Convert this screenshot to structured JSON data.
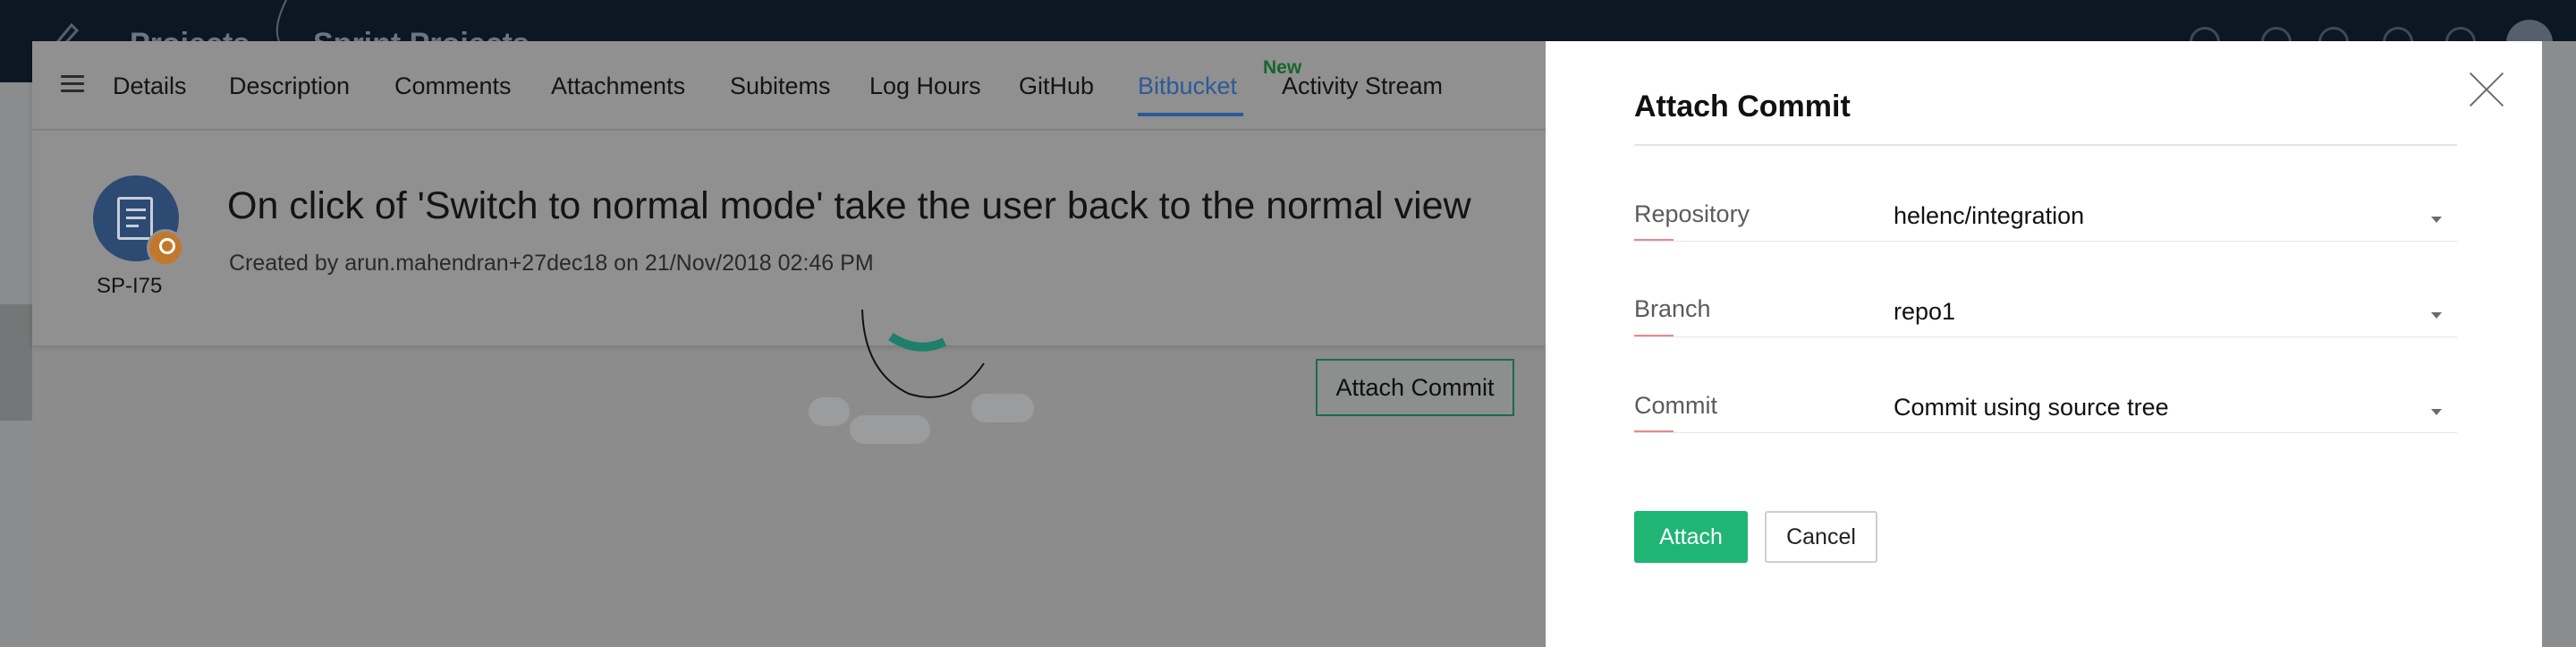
{
  "topbar": {
    "brand_text": "Projects",
    "brand_text2": "Sprint Projects"
  },
  "tabs": [
    {
      "label": "Details"
    },
    {
      "label": "Description"
    },
    {
      "label": "Comments"
    },
    {
      "label": "Attachments"
    },
    {
      "label": "Subitems"
    },
    {
      "label": "Log Hours"
    },
    {
      "label": "GitHub"
    },
    {
      "label": "Bitbucket",
      "active": true,
      "badge": "New"
    },
    {
      "label": "Activity Stream"
    }
  ],
  "item": {
    "id": "SP-I75",
    "title": "On click of 'Switch to normal mode' take the user back to the normal view",
    "meta": "Created by arun.mahendran+27dec18 on 21/Nov/2018 02:46 PM"
  },
  "content": {
    "attach_commit_button": "Attach Commit"
  },
  "panel": {
    "title": "Attach Commit",
    "fields": [
      {
        "label": "Repository",
        "value": "helenc/integration"
      },
      {
        "label": "Branch",
        "value": "repo1"
      },
      {
        "label": "Commit",
        "value": "Commit using source tree"
      }
    ],
    "attach_label": "Attach",
    "cancel_label": "Cancel"
  },
  "colors": {
    "accent_blue": "#2c5a98",
    "attach_green": "#1fb574",
    "required_accent": "#e8898c",
    "new_badge": "#15652e"
  }
}
